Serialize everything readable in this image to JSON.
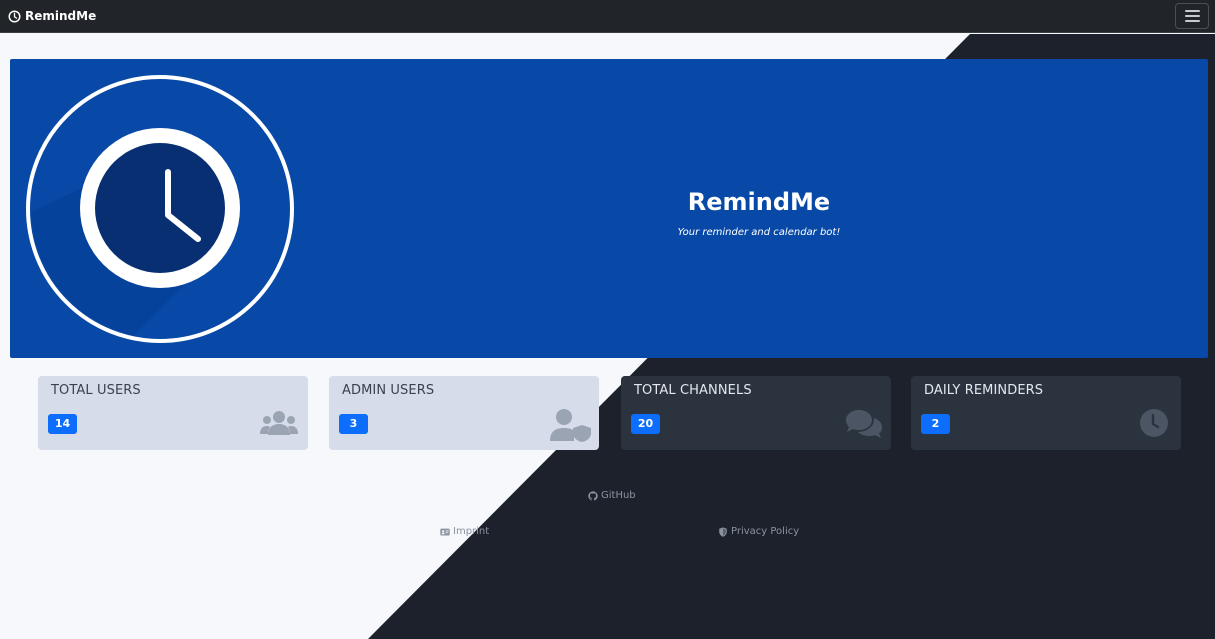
{
  "navbar": {
    "brand": "RemindMe",
    "brand_icon": "clock-icon",
    "menu_icon": "hamburger-menu-icon"
  },
  "hero": {
    "title": "RemindMe",
    "subtitle": "Your reminder and calendar bot!",
    "logo_icon": "clock-logo-icon"
  },
  "stats": [
    {
      "label": "TOTAL USERS",
      "value": "14",
      "icon": "users-icon"
    },
    {
      "label": "ADMIN USERS",
      "value": "3",
      "icon": "user-shield-icon"
    },
    {
      "label": "TOTAL CHANNELS",
      "value": "20",
      "icon": "comments-icon"
    },
    {
      "label": "DAILY REMINDERS",
      "value": "2",
      "icon": "clock-icon"
    }
  ],
  "footer": {
    "github": "GitHub",
    "imprint": "Imprint",
    "privacy": "Privacy Policy"
  },
  "colors": {
    "navbar": "#212529",
    "hero": "#0849a8",
    "badge": "#0d6efd",
    "light_bg": "#f6f8fb",
    "dark_bg": "#1c212b"
  }
}
